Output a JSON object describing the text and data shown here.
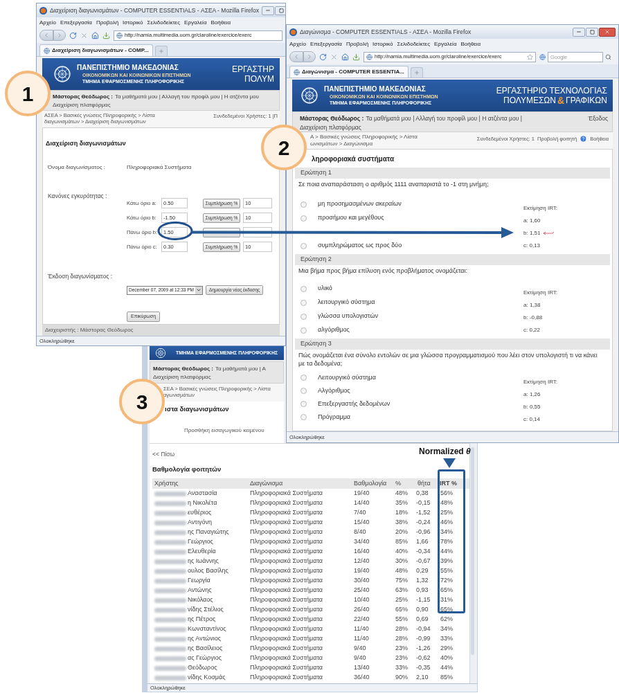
{
  "callouts": [
    {
      "label": "1"
    },
    {
      "label": "2"
    },
    {
      "label": "3"
    }
  ],
  "window_1": {
    "title": "Διαχείριση διαγωνισμάτων - COMPUTER ESSENTIALS - ΑΣΕΑ - Mozilla Firefox",
    "menu": [
      "Αρχείο",
      "Επεξεργασία",
      "Προβολή",
      "Ιστορικό",
      "Σελιδοδείκτες",
      "Εργαλεία",
      "Βοήθεια"
    ],
    "url": "http://namia.multimedia.uom.gr/claroline/exercice/exerc",
    "tab": "Διαχείριση διαγωνισμάτων - COMP...",
    "banner": {
      "university": "ΠΑΝΕΠΙΣΤΗΜΙΟ ΜΑΚΕΔΟΝΙΑΣ",
      "school": "ΟΙΚΟΝΟΜΙΚΩΝ ΚΑΙ ΚΟΙΝΩΝΙΚΩΝ ΕΠΙΣΤΗΜΩΝ",
      "department": "ΤΜΗΜΑ ΕΦΑΡΜΟΣΜΕΝΗΣ ΠΛΗΡΟΦΟΡΙΚΗΣ",
      "lab_line_1": "ΕΡΓΑΣΤΗΡ",
      "lab_line_2": [
        {
          "text": "ΠΟΛΥΜ",
          "kind": "plain"
        }
      ]
    },
    "user": "Μάστορας Θεόδωρος :",
    "user_links": "Τα μαθήματά μου | Αλλαγή του προφίλ μου | Η ατζέντα μου",
    "admin_link": "Διαχείριση πλατφόρμας",
    "breadcrumb": "ΑΣΕΑ > Βασικές γνώσεις Πληροφορικής > Λίστα διαγωνισμάτων > Διαχείριση διαγωνισμάτων",
    "online": "Συνδεδεμένοι Χρήστες: 1 |Π",
    "heading": "Διαχείριση διαγωνισμάτων",
    "name_label": "Όνομα διαγωνίσματος :",
    "name_value": "Πληροφοριακά Συστήματα",
    "rules_label": "Κανόνες εγκυρότητας :",
    "rules": [
      {
        "label": "Κάτω όριο a:",
        "value": "0.50",
        "button": "Συμπλήρωση %",
        "percent": "10",
        "circled": false
      },
      {
        "label": "Κάτω όριο b:",
        "value": "-1.50",
        "button": "Συμπλήρωση %",
        "percent": "10",
        "circled": false
      },
      {
        "label": "Πάνω όριο b:",
        "value": "1.50",
        "circled": true
      },
      {
        "label": "Πάνω όριο c:",
        "value": "0.30",
        "button": "Συμπλήρωση %",
        "percent": "10",
        "circled": false
      }
    ],
    "version_label": "Έκδοση διαγωνίσματος :",
    "version_select": "December 07, 2009 at 12:33 PM",
    "new_version_button": "Δημιουργία νέας έκδοσης",
    "submit_button": "Επικύρωση",
    "footer": "Διαχειριστής : Μάστορας Θεόδωρος",
    "status": "Ολοκληρώθηκε"
  },
  "window_2": {
    "title": "Διαγώνισμα - COMPUTER ESSENTIALS - ΑΣΕΑ - Mozilla Firefox",
    "menu": [
      "Αρχείο",
      "Επεξεργασία",
      "Προβολή",
      "Ιστορικό",
      "Σελιδοδείκτες",
      "Εργαλεία",
      "Βοήθεια"
    ],
    "url": "http://namia.multimedia.uom.gr/claroline/exercice/exerc",
    "search_placeholder": "Google",
    "tab": "Διαγώνισμα - COMPUTER ESSENTIA...",
    "banner": {
      "university": "ΠΑΝΕΠΙΣΤΗΜΙΟ ΜΑΚΕΔΟΝΙΑΣ",
      "school": "ΟΙΚΟΝΟΜΙΚΩΝ ΚΑΙ ΚΟΙΝΩΝΙΚΩΝ ΕΠΙΣΤΗΜΩΝ",
      "department": "ΤΜΗΜΑ ΕΦΑΡΜΟΣΜΕΝΗΣ ΠΛΗΡΟΦΟΡΙΚΗΣ",
      "lab_line_1": "ΕΡΓΑΣΤΗΡΙΟ ΤΕΧΝΟΛΟΓΙΑΣ",
      "lab_line_2": [
        {
          "text": "ΠΟΛΥΜΕΣΩΝ",
          "kind": "plain"
        },
        {
          "text": "&",
          "kind": "accent"
        },
        {
          "text": "ΓΡΑΦΙΚΩΝ",
          "kind": "plain"
        }
      ]
    },
    "user": "Μάστορας Θεόδωρος :",
    "user_links": "Τα μαθήματά μου | Αλλαγή του προφίλ μου | Η ατζέντα μου |",
    "logout": "Έξοδος",
    "admin_link": "Διαχείριση πλατφόρμας",
    "breadcrumb": [
      "Α > Βασικές γνώσεις Πληροφορικής > Λίστα",
      "ωνισμάτων > Διαγώνισμα"
    ],
    "online": "Συνδεδεμένοι Χρήστες: 1",
    "student_view": "Προβολή φοιτητή",
    "help": "Βοήθεια",
    "heading": "ληροφοριακά συστήματα",
    "questions": [
      {
        "header": "Ερώτηση 1",
        "text": "Σε ποια αναπαράσταση ο αριθμός 1111 αναπαριστά το -1 στη μνήμη;",
        "options": [
          {
            "label": "μη προσημασμένων ακεραίων",
            "selected": false
          },
          {
            "label": "προσήμου και μεγέθους",
            "selected": false
          },
          {
            "kind": "covered"
          },
          {
            "label": "συμπληρώματος ως προς δύο",
            "selected": false
          }
        ],
        "irt_title": "Εκτίμηση IRT:",
        "irt": [
          {
            "text": "a: 1,60",
            "flagged": false
          },
          {
            "text": "b: 1,51",
            "flagged": true
          },
          {
            "text": "c: 0,13",
            "flagged": false
          }
        ]
      },
      {
        "header": "Ερώτηση 2",
        "text": "Μια βήμα προς βήμα επίλυση ενός προβλήματος ονομάζεται:",
        "options": [
          {
            "label": "υλικό",
            "selected": false
          },
          {
            "label": "λειτουργικό σύστημα",
            "selected": false
          },
          {
            "label": "γλώσσα υπολογιστών",
            "selected": false
          },
          {
            "label": "αλγόριθμος",
            "selected": false
          }
        ],
        "irt_title": "Εκτίμηση IRT:",
        "irt": [
          {
            "text": "a: 1,38",
            "flagged": false
          },
          {
            "text": "b: -0,88",
            "flagged": false
          },
          {
            "text": "c: 0,22",
            "flagged": false
          }
        ]
      },
      {
        "header": "Ερώτηση 3",
        "text": "Πώς ονομάζεται ένα σύνολο εντολών σε μια γλώσσα προγραμματισμού που λέει στον υπολογιστή τι να κάνει με τα δεδομένα;",
        "options": [
          {
            "label": "Λειτουργικό σύστημα",
            "selected": false
          },
          {
            "label": "Αλγόριθμος",
            "selected": false
          },
          {
            "label": "Επεξεργαστής δεδομένων",
            "selected": false
          },
          {
            "label": "Πρόγραμμα",
            "selected": false
          }
        ],
        "irt_title": "Εκτίμηση IRT:",
        "irt": [
          {
            "text": "a: 1,26",
            "flagged": false
          },
          {
            "text": "b: 0,55",
            "flagged": false
          },
          {
            "text": "c: 0,14",
            "flagged": false
          }
        ]
      }
    ],
    "status": "Ολοκληρώθηκε"
  },
  "window_3": {
    "department": "ΤΜΗΜΑ ΕΦΑΡΜΟΣΜΕΝΗΣ ΠΛΗΡΟΦΟΡΙΚΗΣ",
    "user": "Μάστορας Θεόδωρος :",
    "user_links": "Τα μαθήματά μου | Α",
    "admin_link": "Διαχείριση πλατφόρμας",
    "breadcrumb": [
      "ΣΕΑ > Βασικές γνώσεις Πληροφορικής > Λίστα",
      "αγωνισμάτων"
    ],
    "heading": "ιστα διαγωνισμάτων",
    "intro_link": "Προσθήκη εισαγωγικού κειμένου",
    "back_link": "<< Πίσω",
    "table_title": "Βαθμολογία φοιτητών",
    "columns": [
      {
        "label": "Χρήστης",
        "highlighted": false
      },
      {
        "label": "Διαγώνισμα",
        "highlighted": false
      },
      {
        "label": "Βαθμολογία",
        "highlighted": false
      },
      {
        "label": "%",
        "highlighted": false
      },
      {
        "label": "θήτα",
        "highlighted": false
      },
      {
        "label": "IRT %",
        "highlighted": true
      }
    ],
    "rows": [
      {
        "name": "Αναστασία",
        "exam": "Πληροφοριακά Συστήματα",
        "score": "19/40",
        "percent": "48%",
        "theta": "0,38",
        "irt": "56%"
      },
      {
        "name": "η Νικολέτα",
        "exam": "Πληροφοριακά Συστήματα",
        "score": "14/40",
        "percent": "35%",
        "theta": "-0,15",
        "irt": "48%"
      },
      {
        "name": "ευθέριος",
        "exam": "Πληροφοριακά Συστήματα",
        "score": "7/40",
        "percent": "18%",
        "theta": "-1,52",
        "irt": "25%"
      },
      {
        "name": "Αντιγόνη",
        "exam": "Πληροφοριακά Συστήματα",
        "score": "15/40",
        "percent": "38%",
        "theta": "-0,24",
        "irt": "46%"
      },
      {
        "name": "ης Παναγιώτης",
        "exam": "Πληροφοριακά Συστήματα",
        "score": "8/40",
        "percent": "20%",
        "theta": "-0,96",
        "irt": "34%"
      },
      {
        "name": "Γεώργιος",
        "exam": "Πληροφοριακά Συστήματα",
        "score": "34/40",
        "percent": "85%",
        "theta": "1,66",
        "irt": "78%"
      },
      {
        "name": "Ελευθερία",
        "exam": "Πληροφοριακά Συστήματα",
        "score": "16/40",
        "percent": "40%",
        "theta": "-0,34",
        "irt": "44%"
      },
      {
        "name": "ης Ιωάννης",
        "exam": "Πληροφοριακά Συστήματα",
        "score": "12/40",
        "percent": "30%",
        "theta": "-0,67",
        "irt": "39%"
      },
      {
        "name": "ουλος Βασίλης",
        "exam": "Πληροφοριακά Συστήματα",
        "score": "19/40",
        "percent": "48%",
        "theta": "0,29",
        "irt": "55%"
      },
      {
        "name": "Γεωργία",
        "exam": "Πληροφοριακά Συστήματα",
        "score": "30/40",
        "percent": "75%",
        "theta": "1,32",
        "irt": "72%"
      },
      {
        "name": "Αντώνης",
        "exam": "Πληροφοριακά Συστήματα",
        "score": "25/40",
        "percent": "63%",
        "theta": "0,93",
        "irt": "65%"
      },
      {
        "name": "Νικόλαος",
        "exam": "Πληροφοριακά Συστήματα",
        "score": "10/40",
        "percent": "25%",
        "theta": "-1,15",
        "irt": "31%"
      },
      {
        "name": "νίδης Στέλιος",
        "exam": "Πληροφοριακά Συστήματα",
        "score": "26/40",
        "percent": "65%",
        "theta": "0,90",
        "irt": "65%"
      },
      {
        "name": "ης Πέτρος",
        "exam": "Πληροφοριακά Συστήματα",
        "score": "22/40",
        "percent": "55%",
        "theta": "0,69",
        "irt": "62%"
      },
      {
        "name": "Κωνσταντίνος",
        "exam": "Πληροφοριακά Συστήματα",
        "score": "11/40",
        "percent": "28%",
        "theta": "-0,94",
        "irt": "34%"
      },
      {
        "name": "ης Αντώνιος",
        "exam": "Πληροφοριακά Συστήματα",
        "score": "11/40",
        "percent": "28%",
        "theta": "-0,99",
        "irt": "33%"
      },
      {
        "name": "ης Βασίλειος",
        "exam": "Πληροφοριακά Συστήματα",
        "score": "9/40",
        "percent": "23%",
        "theta": "-1,26",
        "irt": "29%"
      },
      {
        "name": "ας Γεώργιος",
        "exam": "Πληροφοριακά Συστήματα",
        "score": "9/40",
        "percent": "23%",
        "theta": "-0,62",
        "irt": "40%"
      },
      {
        "name": "Θεόδωρος",
        "exam": "Πληροφοριακά Συστήματα",
        "score": "13/40",
        "percent": "33%",
        "theta": "-0,35",
        "irt": "44%"
      },
      {
        "name": "νίδης Κοσμάς",
        "exam": "Πληροφοριακά Συστήματα",
        "score": "36/40",
        "percent": "90%",
        "theta": "2,10",
        "irt": "85%"
      }
    ],
    "status": "Ολοκληρώθηκε"
  },
  "annotation": {
    "label": "Normalized *θ*"
  }
}
